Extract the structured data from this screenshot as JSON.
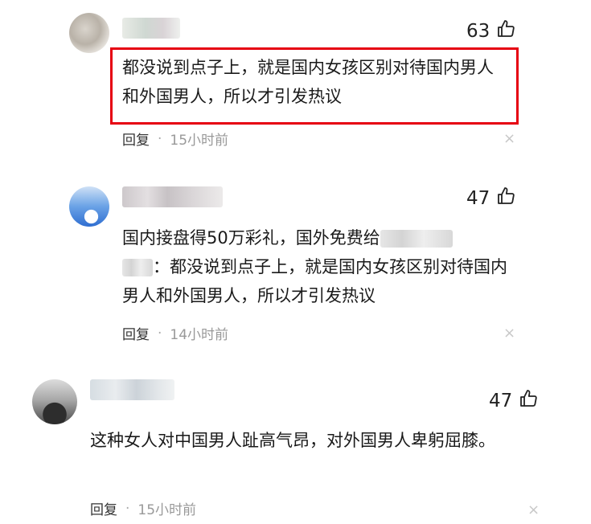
{
  "comments": [
    {
      "likes": "63",
      "text": "都没说到点子上，就是国内女孩区别对待国内男人和外国男人，所以才引发热议",
      "reply_label": "回复",
      "dot": "·",
      "time": "15小时前",
      "close": "×"
    },
    {
      "likes": "47",
      "text_part1": "国内接盘得50万彩礼，国外免费给",
      "text_part2": "：都没说到点子上，就是国内女孩区别对待国内男人和外国男人，所以才引发热议",
      "reply_label": "回复",
      "dot": "·",
      "time": "14小时前",
      "close": "×"
    },
    {
      "likes": "47",
      "text": "这种女人对中国男人趾高气昂，对外国男人卑躬屈膝。",
      "reply_label": "回复",
      "dot": "·",
      "time": "15小时前",
      "close": "×"
    }
  ],
  "colors": {
    "highlight": "#e60012",
    "meta_time": "#999999"
  },
  "icons": {
    "like": "thumbs-up-icon",
    "close": "close-icon"
  }
}
